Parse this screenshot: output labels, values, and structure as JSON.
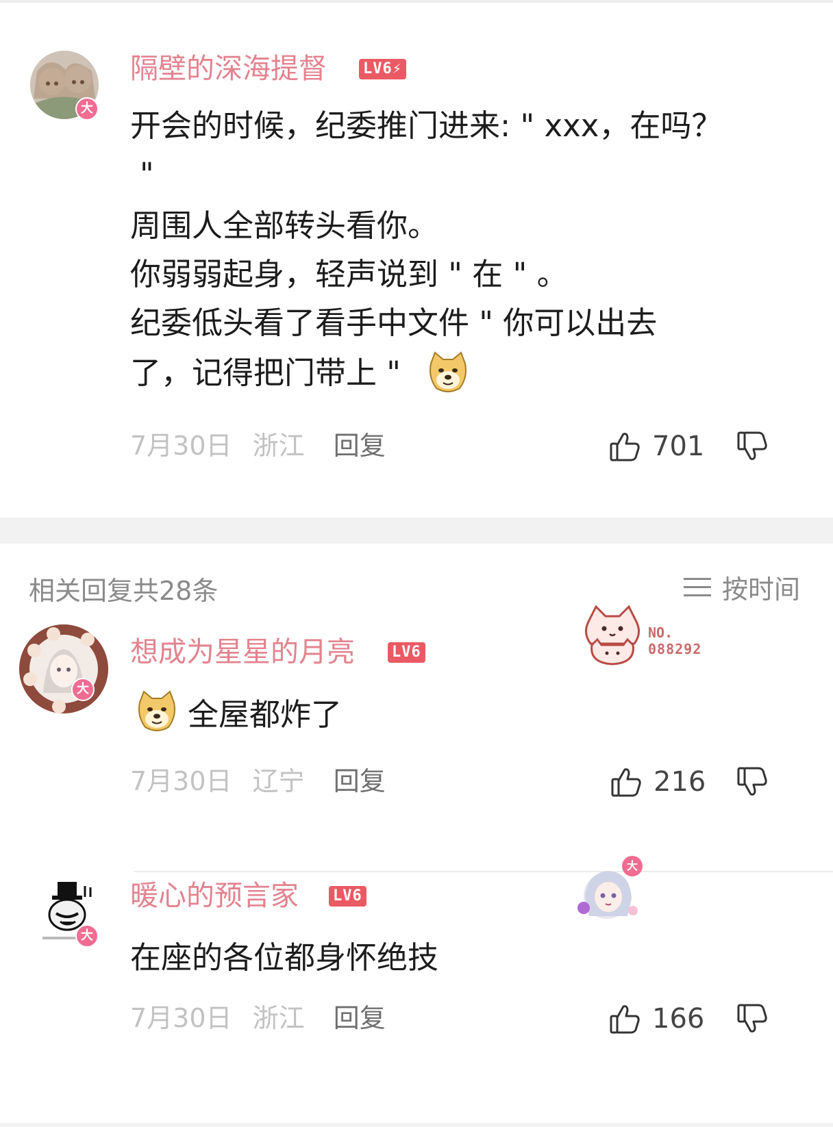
{
  "main_comment": {
    "username": "隔壁的深海提督",
    "level": "LV6",
    "avatar_badge": "大",
    "text_lines": [
      "开会的时候，纪委推门进来: \" xxx，在吗？",
      "\"",
      "周围人全部转头看你。",
      "你弱弱起身，轻声说到 \" 在 \" 。",
      "纪委低头看了看手中文件 \" 你可以出去",
      "了，记得把门带上 \""
    ],
    "date": "7月30日",
    "region": "浙江",
    "reply_label": "回复",
    "likes": "701"
  },
  "replies_header": {
    "count_text": "相关回复共28条",
    "sort_label": "按时间"
  },
  "replies": [
    {
      "username": "想成为星星的月亮",
      "level": "LV6",
      "avatar_badge": "大",
      "text": "全屋都炸了",
      "date": "7月30日",
      "region": "辽宁",
      "reply_label": "回复",
      "likes": "216",
      "fan_badge_no_label": "NO.",
      "fan_badge_number": "088292"
    },
    {
      "username": "暖心的预言家",
      "level": "LV6",
      "avatar_badge": "大",
      "text": "在座的各位都身怀绝技",
      "date": "7月30日",
      "region": "浙江",
      "reply_label": "回复",
      "likes": "166",
      "decoration_badge": "大"
    }
  ],
  "colors": {
    "username": "#e3838f",
    "level_badge": "#ea5a64",
    "avatar_badge": "#f06c92",
    "meta_gray": "#c2c2c2",
    "section_gap": "#f2f2f2"
  }
}
